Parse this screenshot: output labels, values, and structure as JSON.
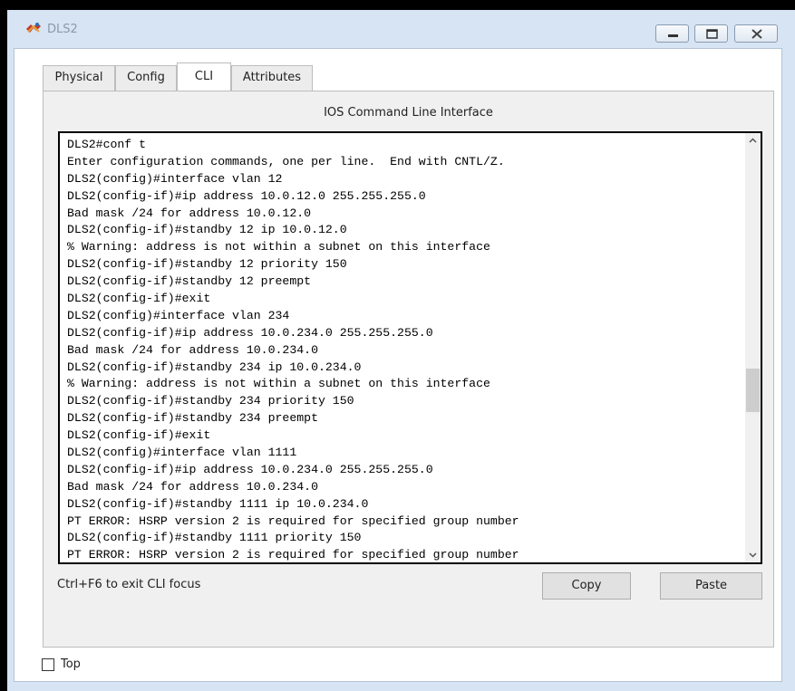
{
  "window": {
    "title": "DLS2",
    "icon": "packet-tracer-device-icon",
    "controls": [
      "minimize-icon",
      "maximize-icon",
      "close-icon"
    ]
  },
  "tabs": [
    {
      "label": "Physical",
      "active": false
    },
    {
      "label": "Config",
      "active": false
    },
    {
      "label": "CLI",
      "active": true
    },
    {
      "label": "Attributes",
      "active": false
    }
  ],
  "cli": {
    "heading": "IOS Command Line Interface",
    "lines": [
      "DLS2#conf t",
      "Enter configuration commands, one per line.  End with CNTL/Z.",
      "DLS2(config)#interface vlan 12",
      "DLS2(config-if)#ip address 10.0.12.0 255.255.255.0",
      "Bad mask /24 for address 10.0.12.0",
      "DLS2(config-if)#standby 12 ip 10.0.12.0",
      "% Warning: address is not within a subnet on this interface",
      "DLS2(config-if)#standby 12 priority 150",
      "DLS2(config-if)#standby 12 preempt",
      "DLS2(config-if)#exit",
      "DLS2(config)#interface vlan 234",
      "DLS2(config-if)#ip address 10.0.234.0 255.255.255.0",
      "Bad mask /24 for address 10.0.234.0",
      "DLS2(config-if)#standby 234 ip 10.0.234.0",
      "% Warning: address is not within a subnet on this interface",
      "DLS2(config-if)#standby 234 priority 150",
      "DLS2(config-if)#standby 234 preempt",
      "DLS2(config-if)#exit",
      "DLS2(config)#interface vlan 1111",
      "DLS2(config-if)#ip address 10.0.234.0 255.255.255.0",
      "Bad mask /24 for address 10.0.234.0",
      "DLS2(config-if)#standby 1111 ip 10.0.234.0",
      "PT ERROR: HSRP version 2 is required for specified group number",
      "DLS2(config-if)#standby 1111 priority 150",
      "PT ERROR: HSRP version 2 is required for specified group number"
    ],
    "scroll_position": 0.62
  },
  "footer": {
    "hint": "Ctrl+F6 to exit CLI focus",
    "copy_label": "Copy",
    "paste_label": "Paste"
  },
  "top_checkbox": {
    "label": "Top",
    "checked": false
  },
  "colors": {
    "frame": "#d6e4f3",
    "title_text": "#8a98a8",
    "panel": "#f0f0f0"
  }
}
